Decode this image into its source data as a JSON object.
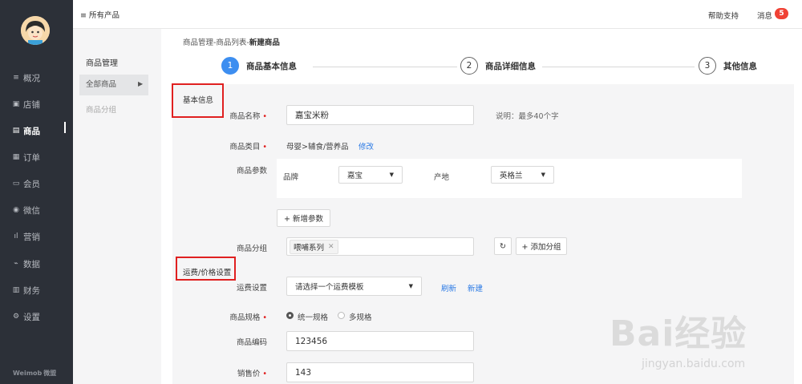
{
  "sidebar": {
    "items": [
      {
        "icon": "≡",
        "label": "概况"
      },
      {
        "icon": "▣",
        "label": "店铺"
      },
      {
        "icon": "▤",
        "label": "商品"
      },
      {
        "icon": "▦",
        "label": "订单"
      },
      {
        "icon": "▭",
        "label": "会员"
      },
      {
        "icon": "◉",
        "label": "微信"
      },
      {
        "icon": "ıl",
        "label": "营销"
      },
      {
        "icon": "⌁",
        "label": "数据"
      },
      {
        "icon": "▥",
        "label": "财务"
      },
      {
        "icon": "⚙",
        "label": "设置"
      }
    ],
    "active_index": 2,
    "logo": "Weimob",
    "logo_sub": "微盟"
  },
  "topbar": {
    "all_products": "≡ 所有产品",
    "help": "帮助支持",
    "messages": "消息",
    "message_count": "5"
  },
  "subnav": {
    "title": "商品管理",
    "active": "全部商品",
    "other": "商品分组"
  },
  "breadcrumb": {
    "path": "商品管理-商品列表-",
    "current": "新建商品"
  },
  "steps": [
    {
      "num": "1",
      "label": "商品基本信息"
    },
    {
      "num": "2",
      "label": "商品详细信息"
    },
    {
      "num": "3",
      "label": "其他信息"
    }
  ],
  "form": {
    "section_basic": "基本信息",
    "name_label": "商品名称",
    "name_value": "嘉宝米粉",
    "name_hint": "说明：最多40个字",
    "category_label": "商品类目",
    "category_value": "母婴>辅食/营养品",
    "category_edit": "修改",
    "params_label": "商品参数",
    "param_brand_label": "品牌",
    "param_brand_value": "嘉宝",
    "param_origin_label": "产地",
    "param_origin_value": "英格兰",
    "add_param": "+ 新增参数",
    "group_label": "商品分组",
    "group_tag": "喂哺系列",
    "add_group": "+ 添加分组",
    "section_shipping": "运费/价格设置",
    "shipping_label": "运费设置",
    "shipping_value": "请选择一个运费模板",
    "shipping_refresh": "刷新",
    "shipping_new": "新建",
    "spec_label": "商品规格",
    "spec_unified": "统一规格",
    "spec_multi": "多规格",
    "code_label": "商品编码",
    "code_value": "123456",
    "price_label": "销售价",
    "price_value": "143"
  },
  "watermark": {
    "text": "Bai经验",
    "url": "jingyan.baidu.com"
  },
  "colors": {
    "sidebar_bg": "#2c3038",
    "accent": "#3d8ef0",
    "link": "#2d7be5",
    "required": "#e02020",
    "badge": "#f04134"
  }
}
